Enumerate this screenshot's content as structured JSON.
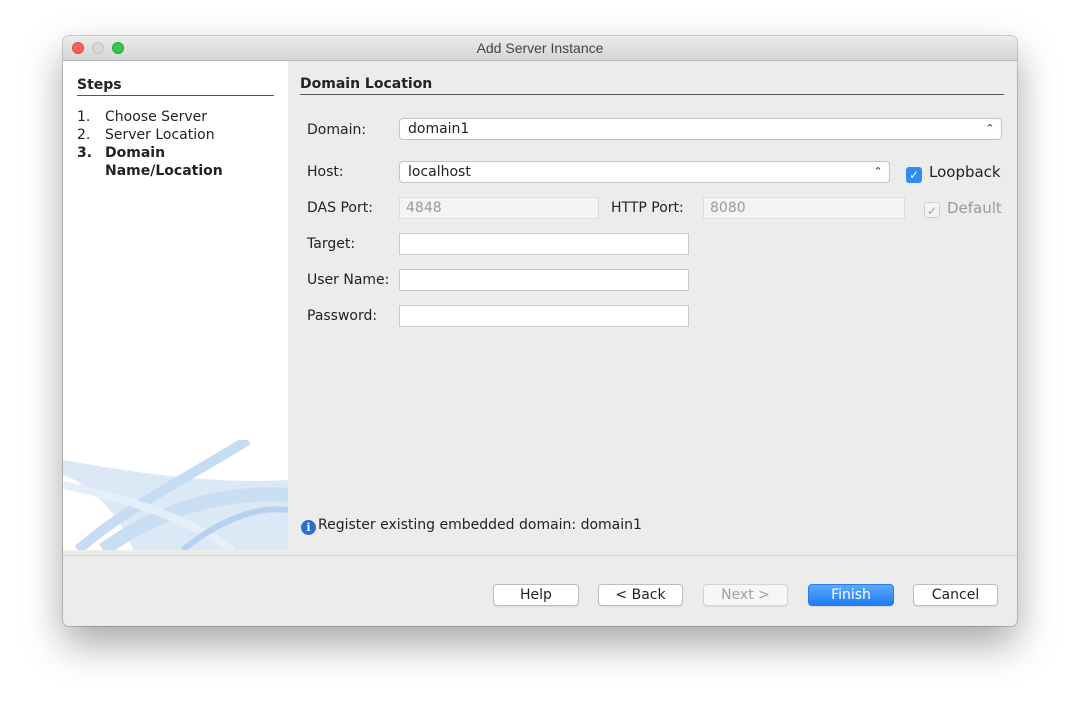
{
  "window": {
    "title": "Add Server Instance"
  },
  "steps": {
    "heading": "Steps",
    "items": [
      {
        "num": "1.",
        "label": "Choose Server"
      },
      {
        "num": "2.",
        "label": "Server Location"
      },
      {
        "num": "3.",
        "label": "Domain Name/Location",
        "current": true
      }
    ]
  },
  "content": {
    "heading": "Domain Location",
    "domain": {
      "label": "Domain:",
      "value": "domain1"
    },
    "host": {
      "label": "Host:",
      "value": "localhost",
      "loopback_label": "Loopback",
      "loopback_checked": true
    },
    "das_port": {
      "label": "DAS Port:",
      "value": "4848"
    },
    "http_port": {
      "label": "HTTP Port:",
      "value": "8080",
      "default_label": "Default",
      "default_checked": true
    },
    "target": {
      "label": "Target:",
      "value": ""
    },
    "username": {
      "label": "User Name:",
      "value": ""
    },
    "password": {
      "label": "Password:",
      "value": ""
    },
    "info_message": "Register existing embedded domain: domain1"
  },
  "buttons": {
    "help": "Help",
    "back": "< Back",
    "next": "Next >",
    "finish": "Finish",
    "cancel": "Cancel"
  },
  "icons": {
    "combo_arrows": "updown-chevron-icon",
    "check": "checkmark-icon",
    "info": "info-icon"
  },
  "colors": {
    "accent": "#2f8cf2",
    "close": "#fc605c",
    "zoom": "#34c84a"
  }
}
